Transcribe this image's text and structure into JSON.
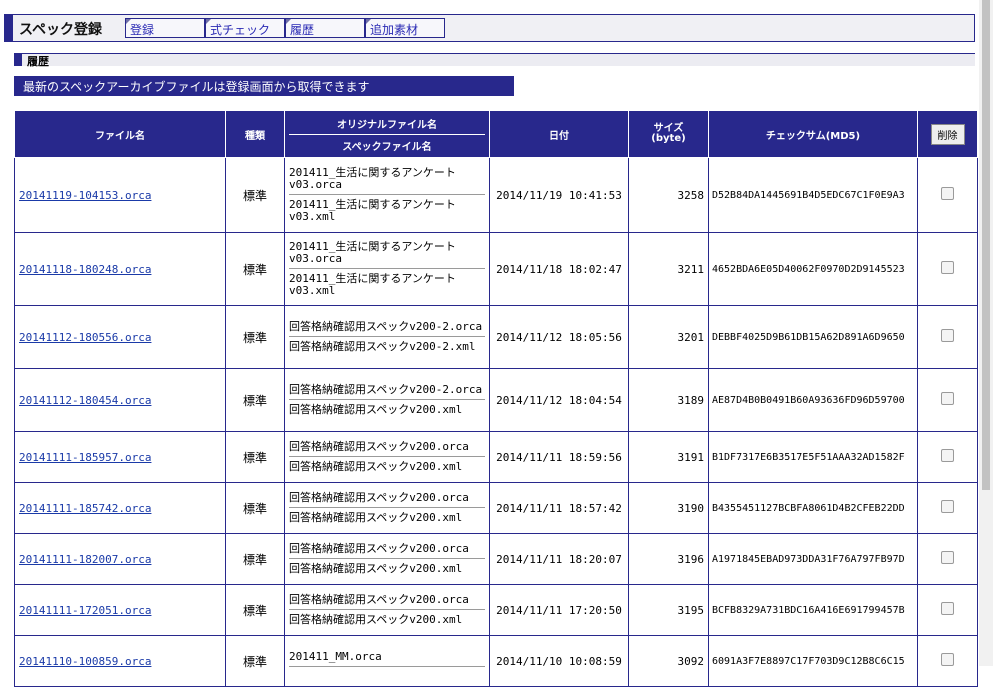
{
  "header": {
    "title": "スペック登録",
    "tabs": [
      {
        "label": "登録"
      },
      {
        "label": "式チェック"
      },
      {
        "label": "履歴"
      },
      {
        "label": "追加素材"
      }
    ]
  },
  "section": {
    "title": "履歴"
  },
  "notice": "最新のスペックアーカイブファイルは登録画面から取得できます",
  "table": {
    "headers": {
      "filename": "ファイル名",
      "type": "種類",
      "original": "オリジナルファイル名",
      "spec": "スペックファイル名",
      "date": "日付",
      "size": "サイズ",
      "size_unit": "(byte)",
      "checksum": "チェックサム(MD5)",
      "delete": "削除"
    },
    "rows": [
      {
        "file": "20141119-104153.orca",
        "type": "標準",
        "orig": "201411_生活に関するアンケートv03.orca",
        "spec": "201411_生活に関するアンケートv03.xml",
        "date": "2014/11/19 10:41:53",
        "size": "3258",
        "md5": "D52B84DA1445691B4D5EDC67C1F0E9A3"
      },
      {
        "file": "20141118-180248.orca",
        "type": "標準",
        "orig": "201411_生活に関するアンケートv03.orca",
        "spec": "201411_生活に関するアンケートv03.xml",
        "date": "2014/11/18 18:02:47",
        "size": "3211",
        "md5": "4652BDA6E05D40062F0970D2D9145523"
      },
      {
        "file": "20141112-180556.orca",
        "type": "標準",
        "orig": "回答格納確認用スペックv200-2.orca",
        "spec": "回答格納確認用スペックv200-2.xml",
        "date": "2014/11/12 18:05:56",
        "size": "3201",
        "md5": "DEBBF4025D9B61DB15A62D891A6D9650"
      },
      {
        "file": "20141112-180454.orca",
        "type": "標準",
        "orig": "回答格納確認用スペックv200-2.orca",
        "spec": "回答格納確認用スペックv200.xml",
        "date": "2014/11/12 18:04:54",
        "size": "3189",
        "md5": "AE87D4B0B0491B60A93636FD96D59700"
      },
      {
        "file": "20141111-185957.orca",
        "type": "標準",
        "orig": "回答格納確認用スペックv200.orca",
        "spec": "回答格納確認用スペックv200.xml",
        "date": "2014/11/11 18:59:56",
        "size": "3191",
        "md5": "B1DF7317E6B3517E5F51AAA32AD1582F"
      },
      {
        "file": "20141111-185742.orca",
        "type": "標準",
        "orig": "回答格納確認用スペックv200.orca",
        "spec": "回答格納確認用スペックv200.xml",
        "date": "2014/11/11 18:57:42",
        "size": "3190",
        "md5": "B4355451127BCBFA8061D4B2CFEB22DD"
      },
      {
        "file": "20141111-182007.orca",
        "type": "標準",
        "orig": "回答格納確認用スペックv200.orca",
        "spec": "回答格納確認用スペックv200.xml",
        "date": "2014/11/11 18:20:07",
        "size": "3196",
        "md5": "A1971845EBAD973DDA31F76A797FB97D"
      },
      {
        "file": "20141111-172051.orca",
        "type": "標準",
        "orig": "回答格納確認用スペックv200.orca",
        "spec": "回答格納確認用スペックv200.xml",
        "date": "2014/11/11 17:20:50",
        "size": "3195",
        "md5": "BCFB8329A731BDC16A416E691799457B"
      },
      {
        "file": "20141110-100859.orca",
        "type": "標準",
        "orig": "201411_MM.orca",
        "spec": "",
        "date": "2014/11/10 10:08:59",
        "size": "3092",
        "md5": "6091A3F7E8897C17F703D9C12B8C6C15"
      }
    ]
  }
}
